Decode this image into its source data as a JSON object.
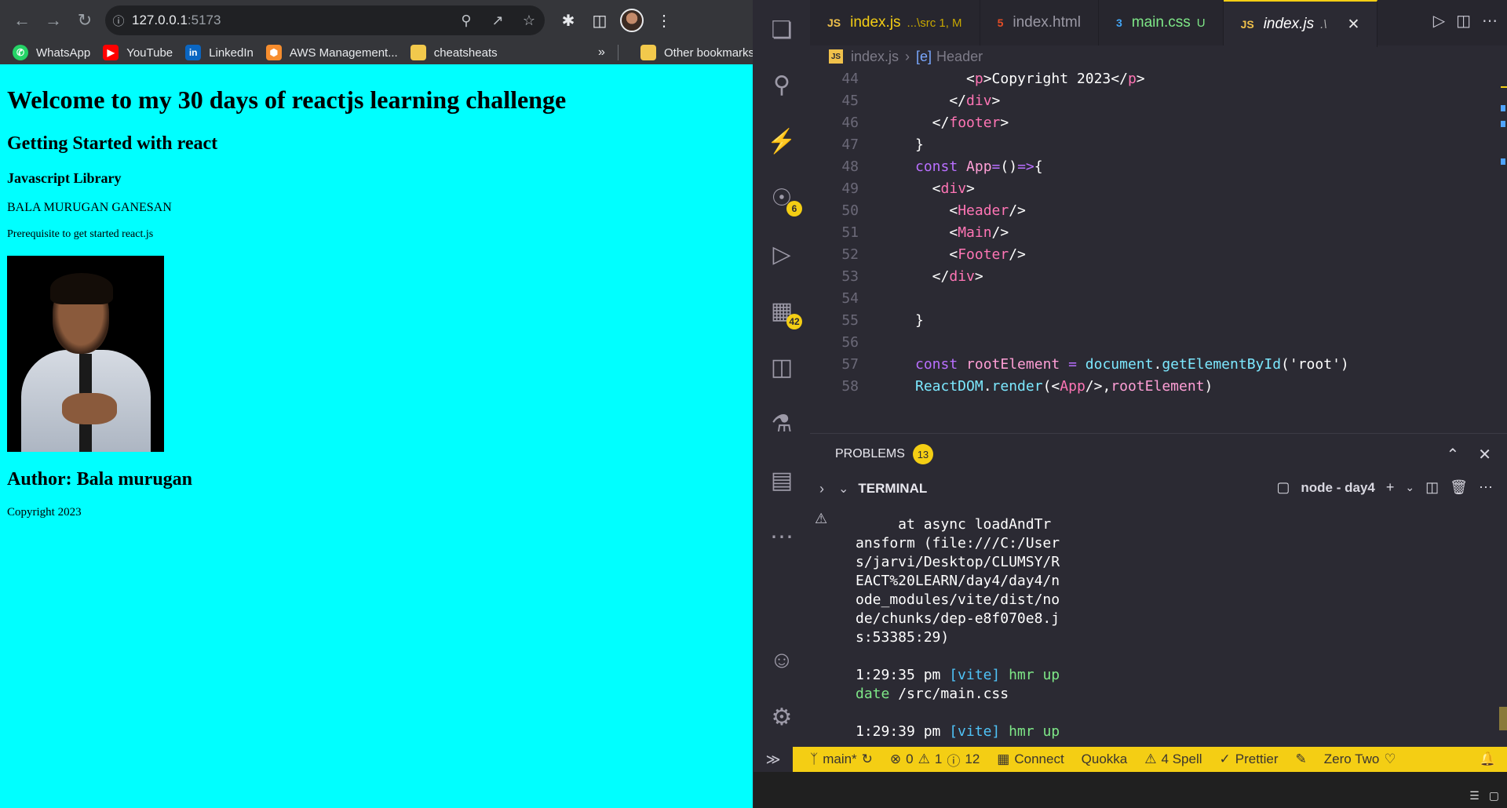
{
  "browser": {
    "url_host": "127.0.0.1",
    "url_port": ":5173",
    "bookmarks": [
      {
        "label": "WhatsApp",
        "color": "#25d366",
        "glyph": "✆"
      },
      {
        "label": "YouTube",
        "color": "#ff0000",
        "glyph": "▶"
      },
      {
        "label": "LinkedIn",
        "color": "#0a66c2",
        "glyph": "in"
      },
      {
        "label": "AWS Management...",
        "color": "#f68d2e",
        "glyph": "⬢"
      },
      {
        "label": "cheatsheats",
        "color": "#f2c94c",
        "glyph": ""
      }
    ],
    "more": "»",
    "other_bookmarks": "Other bookmarks"
  },
  "page": {
    "background": "#00ffff",
    "h1": "Welcome to my 30 days of reactjs learning challenge",
    "h2": "Getting Started with react",
    "h3": "Javascript Library",
    "name": "BALA MURUGAN GANESAN",
    "prereq": "Prerequisite to get started react.js",
    "author": "Author: Bala murugan",
    "copyright": "Copyright 2023"
  },
  "vscode": {
    "accent": "#f4ce14",
    "tabs": [
      {
        "label": "index.js",
        "sub": "...\\src 1, M",
        "icon": "JS",
        "state": "modified"
      },
      {
        "label": "index.html",
        "sub": "",
        "icon": "5",
        "state": "normal"
      },
      {
        "label": "main.css",
        "sub": "U",
        "icon": "3",
        "state": "normal"
      },
      {
        "label": "index.js",
        "sub": ".\\",
        "icon": "JS",
        "state": "active"
      }
    ],
    "breadcrumb": {
      "file": "index.js",
      "symbol": "Header"
    },
    "activity_badges": {
      "source_control": "6",
      "extensions": "42"
    },
    "code_lines": [
      {
        "n": "44",
        "html": "      &lt;<span class='tag'>p</span>&gt;Copyright 2023&lt;/<span class='tag'>p</span>&gt;"
      },
      {
        "n": "45",
        "html": "    &lt;/<span class='tag'>div</span>&gt;"
      },
      {
        "n": "46",
        "html": "  &lt;/<span class='tag'>footer</span>&gt;"
      },
      {
        "n": "47",
        "html": "}"
      },
      {
        "n": "48",
        "html": "<span class='kw'>const</span> <span class='var'>App</span><span class='kw'>=</span>()<span class='kw'>=&gt;</span>{"
      },
      {
        "n": "49",
        "html": "  &lt;<span class='tag'>div</span>&gt;"
      },
      {
        "n": "50",
        "html": "    &lt;<span class='tag'>Header</span>/&gt;"
      },
      {
        "n": "51",
        "html": "    &lt;<span class='tag'>Main</span>/&gt;"
      },
      {
        "n": "52",
        "html": "    &lt;<span class='tag'>Footer</span>/&gt;"
      },
      {
        "n": "53",
        "html": "  &lt;/<span class='tag'>div</span>&gt;"
      },
      {
        "n": "54",
        "html": ""
      },
      {
        "n": "55",
        "html": "}"
      },
      {
        "n": "56",
        "html": ""
      },
      {
        "n": "57",
        "html": "<span class='kw'>const</span> <span class='var'>rootElement</span> <span class='kw'>=</span> <span class='fn'>document</span>.<span class='fn'>getElementById</span>('root')"
      },
      {
        "n": "58",
        "html": "<span class='fn'>ReactDOM</span>.<span class='fn'>render</span>(&lt;<span class='tag'>App</span>/&gt;,<span class='var'>rootElement</span>)"
      }
    ],
    "panel": {
      "problems_label": "PROBLEMS",
      "problems_count": "13",
      "terminal_label": "TERMINAL",
      "terminal_name": "node - day4",
      "output": [
        "     at async loadAndTr",
        "ansform (file:///C:/User",
        "s/jarvi/Desktop/CLUMSY/R",
        "EACT%20LEARN/day4/day4/n",
        "ode_modules/vite/dist/no",
        "de/chunks/dep-e8f070e8.j",
        "s:53385:29)",
        ""
      ],
      "hmr_lines": [
        {
          "time": "1:29:35 pm",
          "tag": "[vite]",
          "msg": "hmr up",
          "rest": "date /src/main.css"
        },
        {
          "time": "1:29:39 pm",
          "tag": "[vite]",
          "msg": "hmr up",
          "rest": ""
        }
      ]
    },
    "status": {
      "branch": "main*",
      "errors": "0",
      "warnings": "1",
      "info": "12",
      "connect": "Connect",
      "quokka": "Quokka",
      "spell": "4 Spell",
      "prettier": "Prettier",
      "theme": "Zero Two"
    }
  }
}
